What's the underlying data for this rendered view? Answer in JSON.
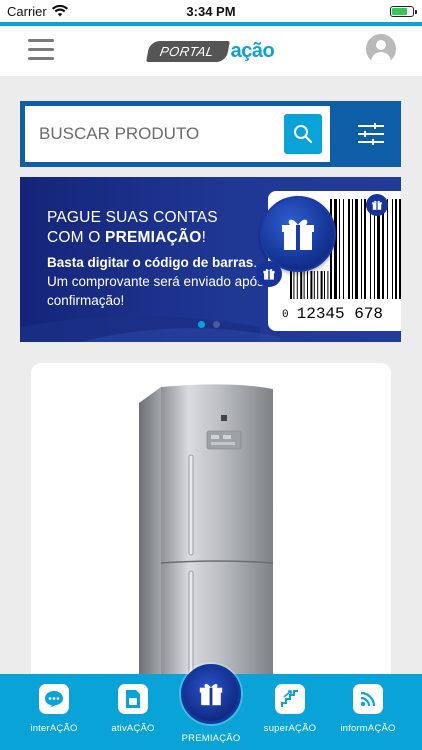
{
  "status_bar": {
    "carrier": "Carrier",
    "time": "3:34 PM",
    "battery_level": 0.75
  },
  "header": {
    "logo_portal": "PORTAL",
    "logo_acao": "ação",
    "menu_icon": "hamburger-menu-icon",
    "profile_icon": "user-avatar-icon"
  },
  "search": {
    "placeholder": "BUSCAR PRODUTO",
    "value": "",
    "search_icon": "magnifier-icon",
    "filter_icon": "sliders-icon"
  },
  "banner": {
    "headline_line1": "PAGUE SUAS CONTAS",
    "headline_line2_prefix": "COM O ",
    "headline_line2_bold": "PREMIAÇÃO",
    "headline_line2_suffix": "!",
    "body_bold": "Basta digitar o código de barras",
    "body_rest": ". Um comprovante será enviado após a confirmação!",
    "barcode_number_prefix": "0",
    "barcode_number": "12345 678",
    "slides_total": 2,
    "active_slide": 1
  },
  "product": {
    "image": "stainless-steel-refrigerator"
  },
  "colors": {
    "accent": "#0aa3d8",
    "primary_dark": "#0d5ea6",
    "banner_navy": "#1f3894"
  },
  "bottom_nav": {
    "items": [
      {
        "label": "interAÇÃO",
        "icon": "chat-bubble-icon"
      },
      {
        "label": "ativAÇÃO",
        "icon": "sim-card-icon"
      },
      {
        "label": "PREMIAÇÃO",
        "icon": "gift-icon"
      },
      {
        "label": "superAÇÃO",
        "icon": "stairs-icon"
      },
      {
        "label": "informAÇÃO",
        "icon": "rss-feed-icon"
      }
    ]
  }
}
